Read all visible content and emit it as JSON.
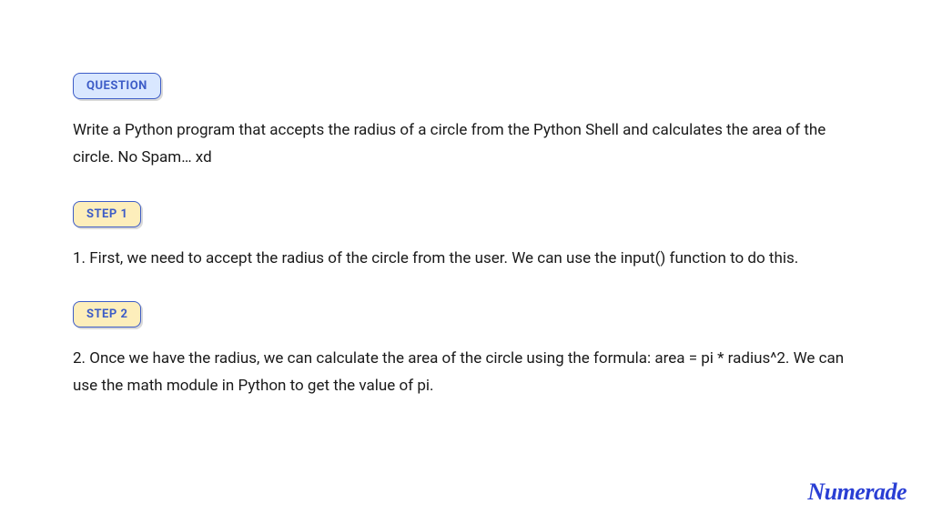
{
  "question": {
    "badge_label": "QUESTION",
    "text": "Write a Python program that accepts the radius of a circle from the Python Shell and calculates the area of the circle. No Spam… xd"
  },
  "steps": [
    {
      "badge_label": "STEP 1",
      "text": "1. First, we need to accept the radius of the circle from the user. We can use the input() function to do this."
    },
    {
      "badge_label": "STEP 2",
      "text": "2. Once we have the radius, we can calculate the area of the circle using the formula: area = pi * radius^2. We can use the math module in Python to get the value of pi."
    }
  ],
  "brand": {
    "name": "Numerade"
  }
}
